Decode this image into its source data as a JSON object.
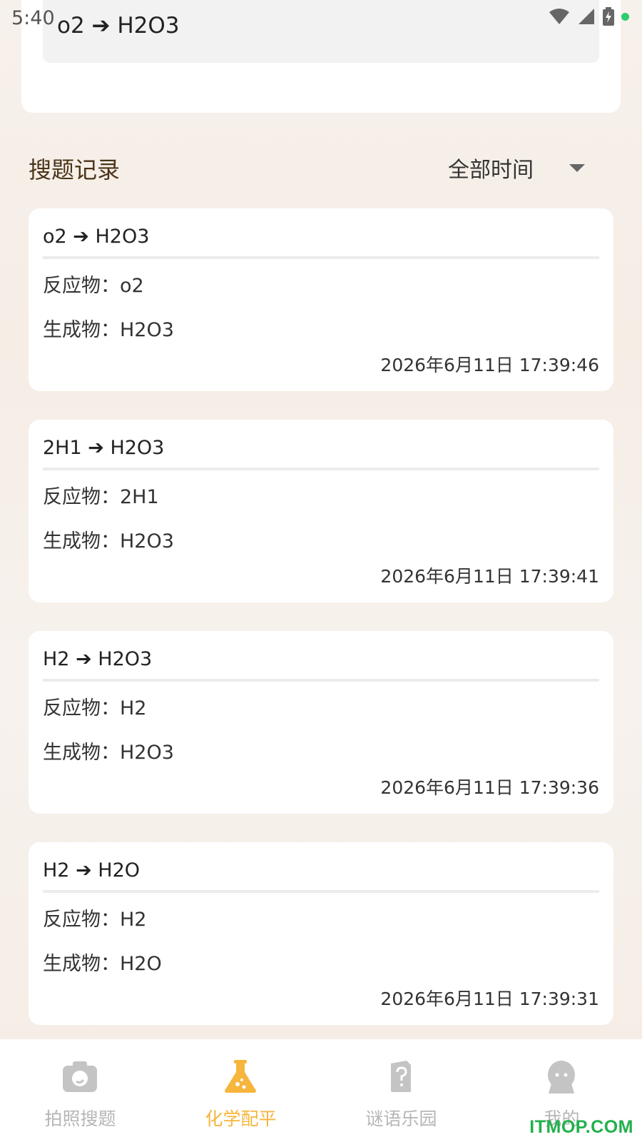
{
  "status_bar": {
    "time": "5:40"
  },
  "input": {
    "value": "o2 ➔ H2O3"
  },
  "history": {
    "title": "搜题记录",
    "time_filter": "全部时间",
    "records": [
      {
        "title": "o2 ➔ H2O3",
        "reactant": "反应物：o2",
        "product": "生成物：H2O3",
        "time": "2026年6月11日 17:39:46"
      },
      {
        "title": "2H1 ➔ H2O3",
        "reactant": "反应物：2H1",
        "product": "生成物：H2O3",
        "time": "2026年6月11日 17:39:41"
      },
      {
        "title": "H2 ➔ H2O3",
        "reactant": "反应物：H2",
        "product": "生成物：H2O3",
        "time": "2026年6月11日 17:39:36"
      },
      {
        "title": "H2 ➔ H2O",
        "reactant": "反应物：H2",
        "product": "生成物：H2O",
        "time": "2026年6月11日 17:39:31"
      }
    ]
  },
  "tabbar": {
    "tabs": [
      {
        "label": "拍照搜题",
        "icon": "camera-icon",
        "active": false
      },
      {
        "label": "化学配平",
        "icon": "flask-icon",
        "active": true
      },
      {
        "label": "谜语乐园",
        "icon": "question-book-icon",
        "active": false
      },
      {
        "label": "我的",
        "icon": "profile-icon",
        "active": false
      }
    ]
  },
  "watermark": "ITMOP.COM",
  "colors": {
    "accent": "#f6b53c",
    "inactive": "#b6b6b6",
    "title_brown": "#4a3418",
    "watermark": "#21b04b"
  }
}
